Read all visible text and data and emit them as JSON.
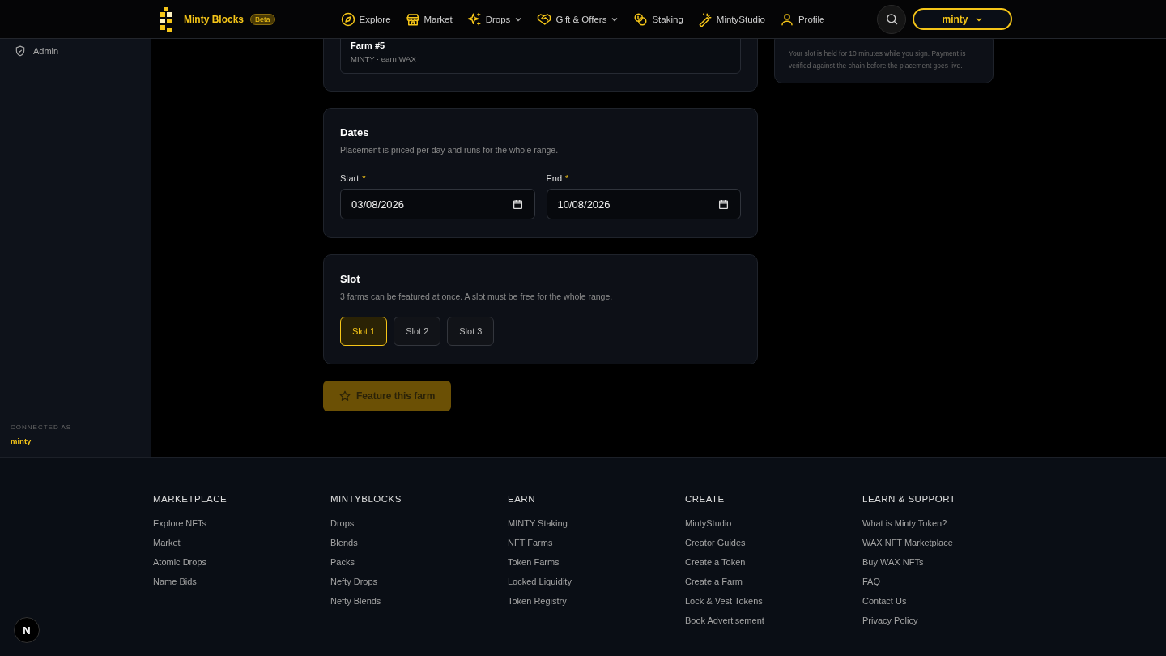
{
  "header": {
    "brand": "Minty Blocks",
    "badge": "Beta",
    "nav": [
      {
        "label": "Explore",
        "dropdown": false
      },
      {
        "label": "Market",
        "dropdown": false
      },
      {
        "label": "Drops",
        "dropdown": true
      },
      {
        "label": "Gift & Offers",
        "dropdown": true
      },
      {
        "label": "Staking",
        "dropdown": false
      },
      {
        "label": "MintyStudio",
        "dropdown": false
      },
      {
        "label": "Profile",
        "dropdown": false
      }
    ],
    "account": "minty"
  },
  "sidebar": {
    "items": [
      {
        "label": "Admin",
        "selected": false
      }
    ],
    "connected_label": "CONNECTED AS",
    "connected_user": "minty"
  },
  "farm_card": {
    "name": "Farm #5",
    "subtitle": "MINTY · earn WAX"
  },
  "dates": {
    "title": "Dates",
    "description": "Placement is priced per day and runs for the whole range.",
    "fields": [
      {
        "label": "Start",
        "required_mark": "*",
        "value": "03/08/2026"
      },
      {
        "label": "End",
        "required_mark": "*",
        "value": "10/08/2026"
      }
    ]
  },
  "slot": {
    "title": "Slot",
    "description": "3 farms can be featured at once. A slot must be free for the whole range.",
    "options": [
      {
        "label": "Slot 1",
        "selected": true
      },
      {
        "label": "Slot 2",
        "selected": false
      },
      {
        "label": "Slot 3",
        "selected": false
      }
    ]
  },
  "submit": {
    "label": "Feature this farm",
    "disabled": true
  },
  "note": "Your slot is held for 10 minutes while you sign. Payment is verified against the chain before the placement goes live.",
  "footer": {
    "columns": [
      {
        "heading": "MARKETPLACE",
        "links": [
          "Explore NFTs",
          "Market",
          "Atomic Drops",
          "Name Bids"
        ]
      },
      {
        "heading": "MINTYBLOCKS",
        "links": [
          "Drops",
          "Blends",
          "Packs",
          "Nefty Drops",
          "Nefty Blends"
        ]
      },
      {
        "heading": "EARN",
        "links": [
          "MINTY Staking",
          "NFT Farms",
          "Token Farms",
          "Locked Liquidity",
          "Token Registry"
        ]
      },
      {
        "heading": "CREATE",
        "links": [
          "MintyStudio",
          "Creator Guides",
          "Create a Token",
          "Create a Farm",
          "Lock & Vest Tokens",
          "Book Advertisement"
        ]
      },
      {
        "heading": "LEARN & SUPPORT",
        "links": [
          "What is Minty Token?",
          "WAX NFT Marketplace",
          "Buy WAX NFTs",
          "FAQ",
          "Contact Us",
          "Privacy Policy"
        ]
      }
    ],
    "dev_badge": "N"
  }
}
